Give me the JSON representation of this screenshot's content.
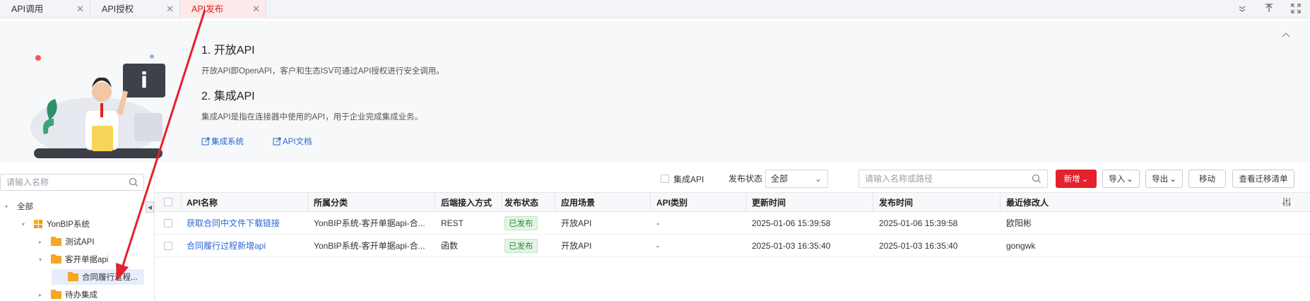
{
  "tabs": [
    {
      "label": "API调用",
      "active": false
    },
    {
      "label": "API授权",
      "active": false
    },
    {
      "label": "API发布",
      "active": true
    }
  ],
  "banner": {
    "heading1": "1. 开放API",
    "desc1": "开放API即OpenAPI，客户和生态ISV可通过API授权进行安全调用。",
    "heading2": "2. 集成API",
    "desc2": "集成API是指在连接器中使用的API，用于企业完成集成业务。",
    "link1": "集成系统",
    "link2": "API文档"
  },
  "tree": {
    "search_placeholder": "请输入名称",
    "nodes": [
      {
        "label": "全部"
      },
      {
        "label": "YonBIP系统"
      },
      {
        "label": "测试API"
      },
      {
        "label": "客开单据api"
      },
      {
        "label": "合同履行过程..."
      },
      {
        "label": "待办集成"
      }
    ]
  },
  "toolbar": {
    "integration_api_label": "集成API",
    "status_label": "发布状态",
    "status_value": "全部",
    "search_placeholder": "请输入名称或路径",
    "add_label": "新增",
    "import_label": "导入",
    "export_label": "导出",
    "move_label": "移动",
    "migrate_label": "查看迁移清单"
  },
  "table": {
    "columns": [
      "API名称",
      "所属分类",
      "后端接入方式",
      "发布状态",
      "应用场景",
      "API类别",
      "更新时间",
      "发布时间",
      "最近修改人"
    ],
    "rows": [
      [
        "获取合同中文件下载链接",
        "YonBIP系统-客开单据api-合...",
        "REST",
        "已发布",
        "开放API",
        "-",
        "2025-01-06 15:39:58",
        "2025-01-06 15:39:58",
        "欧阳彬"
      ],
      [
        "合同履行过程新增api",
        "YonBIP系统-客开单据api-合...",
        "函数",
        "已发布",
        "开放API",
        "-",
        "2025-01-03 16:35:40",
        "2025-01-03 16:35:40",
        "gongwk"
      ]
    ]
  },
  "colors": {
    "accent": "#e4212d",
    "link": "#2a66d3",
    "published_bg": "#e3f5e6",
    "published_text": "#2a8c3f"
  }
}
